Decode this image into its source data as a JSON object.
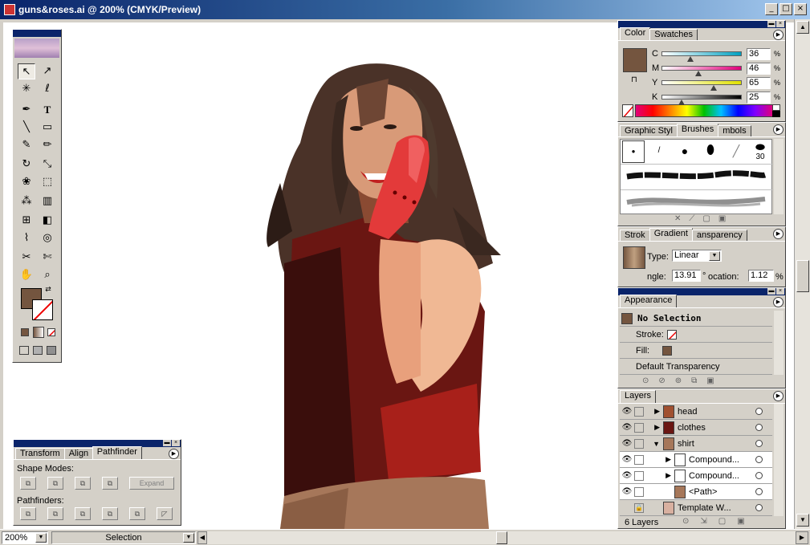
{
  "window": {
    "title": "guns&roses.ai @ 200% (CMYK/Preview)",
    "min": "_",
    "max": "□",
    "close": "×"
  },
  "status": {
    "zoom": "200%",
    "tool": "Selection"
  },
  "color_panel": {
    "tabs": [
      "Color",
      "Swatches"
    ],
    "fill_color": "#74553f",
    "channels": [
      {
        "label": "C",
        "value": "36",
        "unit": "%"
      },
      {
        "label": "M",
        "value": "46",
        "unit": "%"
      },
      {
        "label": "Y",
        "value": "65",
        "unit": "%"
      },
      {
        "label": "K",
        "value": "25",
        "unit": "%"
      }
    ]
  },
  "brushes_panel": {
    "tabs": [
      "Graphic Styl",
      "Brushes",
      "mbols"
    ],
    "brush_size": "30"
  },
  "gradient_panel": {
    "tabs": [
      "Strok",
      "Gradient",
      "ansparency"
    ],
    "type_label": "Type:",
    "type_value": "Linear",
    "angle_label": "ngle:",
    "angle_value": "13.91",
    "angle_unit": "°",
    "location_label": "ocation:",
    "location_value": "1.12",
    "location_unit": "%"
  },
  "appearance_panel": {
    "tab": "Appearance",
    "selection": "No Selection",
    "stroke_label": "Stroke:",
    "fill_label": "Fill:",
    "transparency": "Default Transparency"
  },
  "layers_panel": {
    "tab": "Layers",
    "rows": [
      {
        "name": "head"
      },
      {
        "name": "clothes"
      },
      {
        "name": "shirt"
      },
      {
        "name": "Compound..."
      },
      {
        "name": "Compound..."
      },
      {
        "name": "<Path>"
      },
      {
        "name": "Template W..."
      }
    ],
    "count": "6 Layers"
  },
  "pathfinder_panel": {
    "tabs": [
      "Transform",
      "Align",
      "Pathfinder"
    ],
    "shape_modes_label": "Shape Modes:",
    "expand_label": "Expand",
    "pathfinders_label": "Pathfinders:"
  },
  "tools": {
    "type_tool": "T"
  }
}
